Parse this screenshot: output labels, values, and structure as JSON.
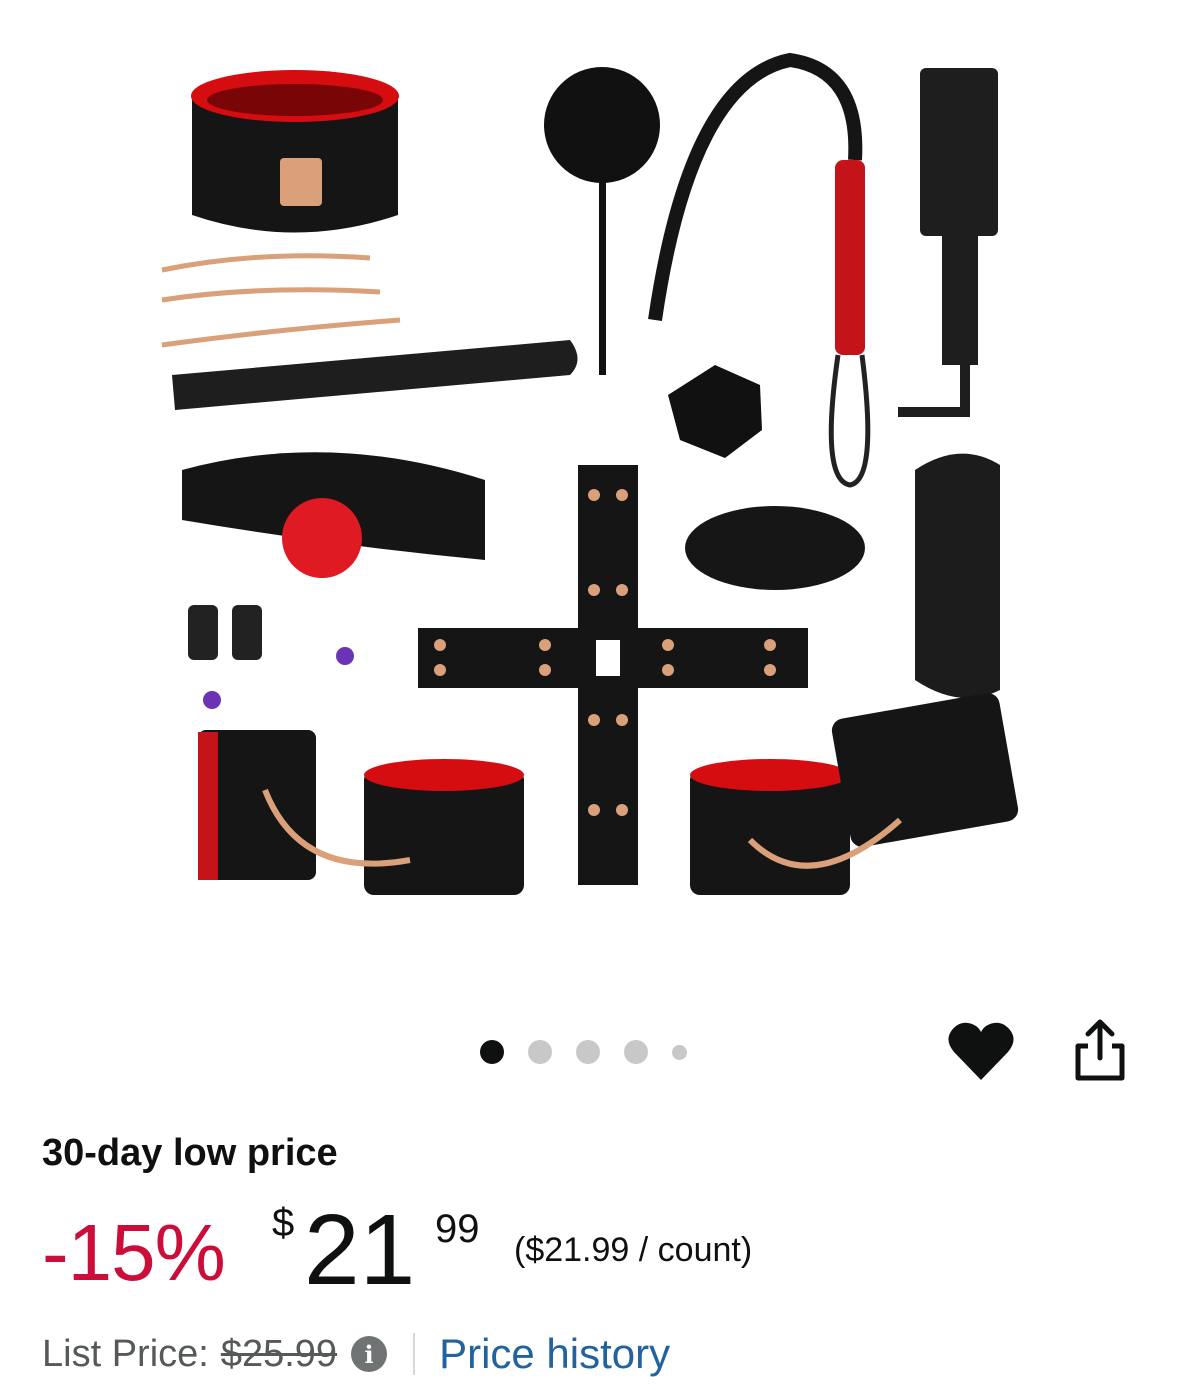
{
  "product_image": {
    "icon": "product-photo",
    "colors": {
      "leather": "#151515",
      "lining": "#d50d10",
      "metal": "#d9a07a"
    }
  },
  "carousel": {
    "count": 5,
    "active_index": 0
  },
  "actions": {
    "wishlist_icon": "heart-icon",
    "share_icon": "share-icon"
  },
  "deal": {
    "label": "30-day low price"
  },
  "price": {
    "discount": "-15%",
    "currency": "$",
    "whole": "21",
    "fraction": "99",
    "unit_price": "($21.99 / count)"
  },
  "list_price": {
    "label": "List Price:",
    "value": "$25.99",
    "info_icon": "i"
  },
  "price_history": {
    "label": "Price history"
  },
  "colors": {
    "discount": "#cc0c39",
    "link": "#2162a1",
    "text": "#0f1111",
    "muted": "#565959"
  }
}
